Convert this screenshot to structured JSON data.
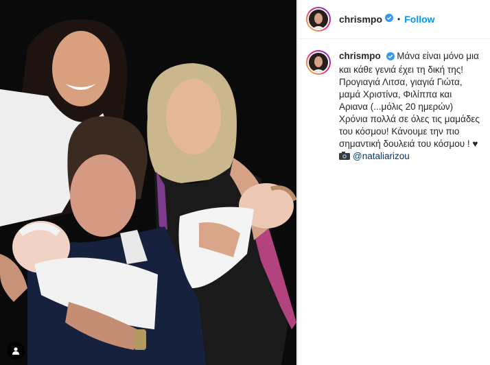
{
  "post": {
    "username": "chrismpo",
    "separator": "•",
    "follow_label": "Follow",
    "caption_first_line": "Μάνα είναι μόνο μια και κάθε γενιά έχει τη δική της!",
    "caption_line_2": "Προγιαγιά Λιτσα, γιαγιά Γιώτα, μαμά Χριστίνα, Φιλίππα και Αριανα (...μόλις 20 ημερών)",
    "caption_line_3": "Χρόνια πολλά σε όλες τις μαμάδες του κόσμου! Κάνουμε την πιο σημαντική δουλειά του κόσμου ! ♥",
    "mention": "@nataliarizou",
    "icons": [
      "verified-badge-icon",
      "camera-icon",
      "user-tag-icon"
    ],
    "colors": {
      "follow": "#0095f6",
      "verified": "#3897f0",
      "mention": "#00376b",
      "text": "#262626"
    }
  }
}
